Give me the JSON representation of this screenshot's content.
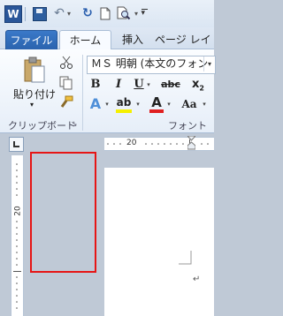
{
  "quick_access": {
    "app_icon_letter": "W",
    "undo_glyph": "↶",
    "redo_glyph": "↻",
    "new_glyph": "🗋",
    "print_preview_glyph": "🔍",
    "customize_glyph": "▾"
  },
  "tabs": [
    {
      "label": "ファイル"
    },
    {
      "label": "ホーム"
    },
    {
      "label": "挿入"
    },
    {
      "label": "ページ レイ"
    }
  ],
  "clipboard_group": {
    "paste_label": "貼り付け",
    "paste_arrow": "▾",
    "group_label": "クリップボード",
    "launcher_glyph": "↘"
  },
  "font_group": {
    "font_name": "ＭＳ 明朝 (本文のフォン",
    "font_arrow": "▾",
    "bold": "B",
    "italic": "I",
    "underline": "U",
    "strike": "abc",
    "subscript": "x",
    "sub_digit": "2",
    "text_effects": "A",
    "highlight": "ab",
    "font_color": "A",
    "font_color_value": "#e02020",
    "change_case": "Aa",
    "group_label": "フォント"
  },
  "ruler": {
    "horizontal_number": "20",
    "vertical_number": "20"
  },
  "document": {
    "paragraph_mark": "↵"
  },
  "colors": {
    "file_tab": "#2a62ad",
    "highlight_box": "#e61515"
  }
}
